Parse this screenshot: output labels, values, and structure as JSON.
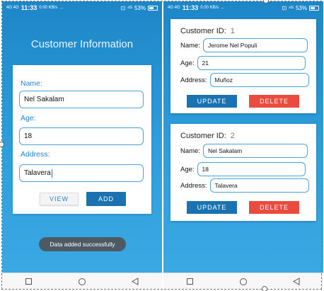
{
  "colors": {
    "app_blue": "#2f9fdc",
    "accent_blue": "#1a73b0",
    "delete_red": "#ea4b3e",
    "label_blue": "#1f86c6"
  },
  "status_bar": {
    "signal": "4G 4G",
    "time": "11:33",
    "speed": "0.00 KB/s",
    "dots": "··",
    "right_icons": "⊡ ⁴ᴳ",
    "battery": "53%"
  },
  "nav_icons": [
    "square-icon",
    "circle-icon",
    "triangle-back-icon"
  ],
  "left_screen": {
    "title": "Customer Information",
    "form": {
      "name_label": "Name:",
      "name_value": "Nel Sakalam",
      "age_label": "Age:",
      "age_value": "18",
      "address_label": "Address:",
      "address_value": "Talavera"
    },
    "buttons": {
      "view": "VIEW",
      "add": "ADD"
    },
    "toast": "Data added successfully"
  },
  "right_screen": {
    "customers": [
      {
        "id_label": "Customer ID:",
        "id": "1",
        "name_label": "Name:",
        "name": "Jerome Nel Populi",
        "age_label": "Age:",
        "age": "21",
        "address_label": "Address:",
        "address": "Muñoz",
        "update": "UPDATE",
        "delete": "DELETE"
      },
      {
        "id_label": "Customer ID:",
        "id": "2",
        "name_label": "Name:",
        "name": "Nel Sakalam",
        "age_label": "Age:",
        "age": "18",
        "address_label": "Address:",
        "address": "Talavera",
        "update": "UPDATE",
        "delete": "DELETE"
      }
    ]
  }
}
